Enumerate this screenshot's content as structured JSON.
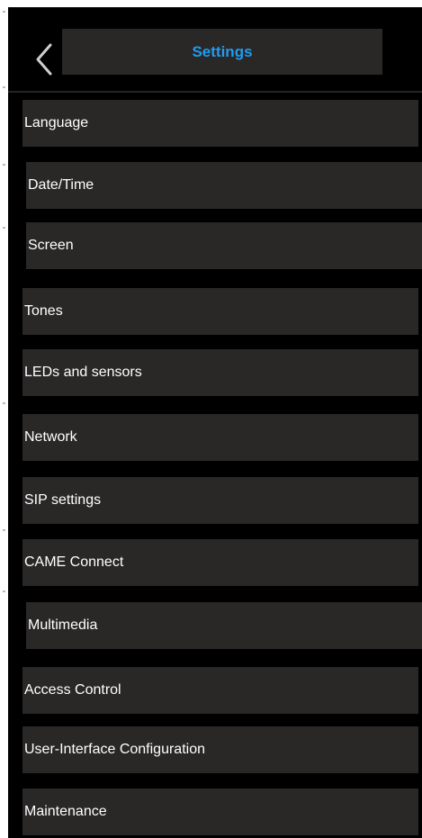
{
  "header": {
    "title": "Settings",
    "back_icon": "chevron-left-icon"
  },
  "colors": {
    "background": "#000000",
    "item_background": "#2a2727",
    "title": "#1e9cf0",
    "text": "#ffffff"
  },
  "menu": {
    "items": [
      {
        "label": "Language"
      },
      {
        "label": "Date/Time"
      },
      {
        "label": "Screen"
      },
      {
        "label": "Tones"
      },
      {
        "label": "LEDs and sensors"
      },
      {
        "label": "Network"
      },
      {
        "label": "SIP settings"
      },
      {
        "label": "CAME Connect"
      },
      {
        "label": "Multimedia"
      },
      {
        "label": "Access Control"
      },
      {
        "label": "User-Interface Configuration"
      },
      {
        "label": "Maintenance"
      }
    ]
  }
}
